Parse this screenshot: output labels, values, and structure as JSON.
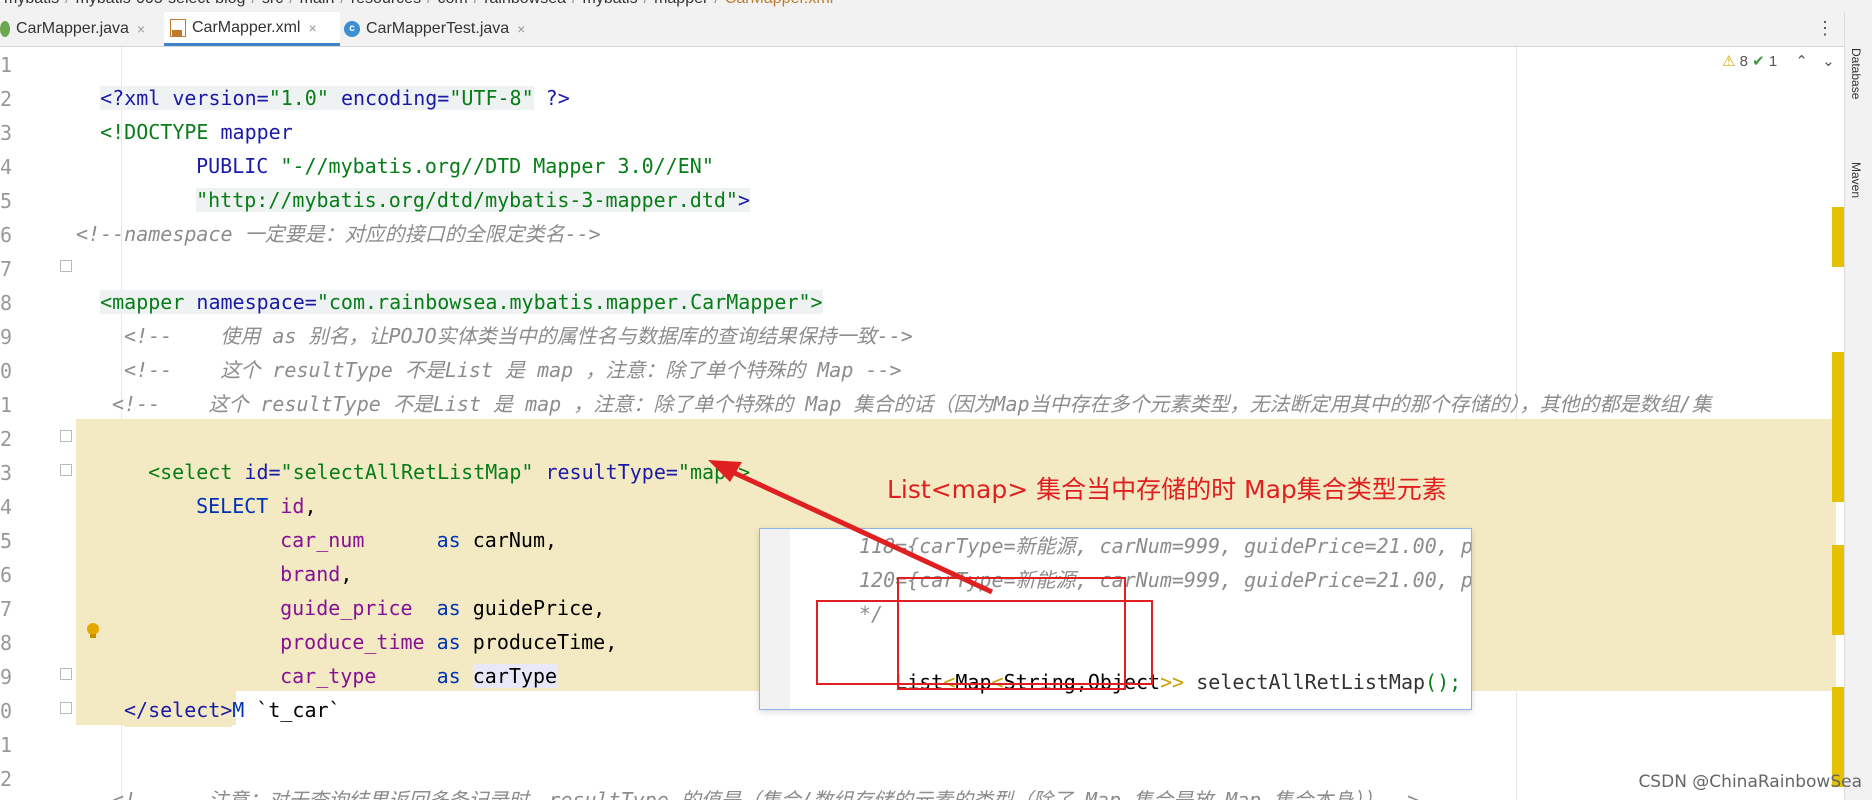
{
  "breadcrumb": [
    "mybatis",
    "mybatis-005-select-blog",
    "src",
    "main",
    "resources",
    "com",
    "rainbowsea",
    "mybatis",
    "mapper",
    "CarMapper.xml"
  ],
  "tabs": [
    {
      "label": "CarMapper.java",
      "icon": "interface-icon",
      "active": false
    },
    {
      "label": "CarMapper.xml",
      "icon": "xml-file-icon",
      "active": true
    },
    {
      "label": "CarMapperTest.java",
      "icon": "class-icon",
      "active": false
    }
  ],
  "tab_close_glyph": "×",
  "more_glyph": "⋮",
  "inspections": {
    "warnings": "8",
    "checks": "1",
    "warn_icon": "⚠",
    "check_icon": "✔",
    "up": "⌃",
    "down": "⌄"
  },
  "side_tabs": [
    "Database",
    "Maven"
  ],
  "line_numbers": [
    "1",
    "2",
    "3",
    "4",
    "5",
    "6",
    "7",
    "8",
    "9",
    "0",
    "1",
    "2",
    "3",
    "4",
    "5",
    "6",
    "7",
    "8",
    "9",
    "0",
    "1",
    "2"
  ],
  "code": {
    "l1": {
      "a": "<?",
      "b": "xml version=",
      "c": "\"1.0\"",
      "d": " encoding=",
      "e": "\"UTF-8\"",
      "f": " ?>"
    },
    "l2": {
      "a": "<!DOCTYPE ",
      "b": "mapper"
    },
    "l3": {
      "a": "PUBLIC ",
      "b": "\"-//mybatis.org//DTD Mapper 3.0//EN\""
    },
    "l4": {
      "a": "\"http://mybatis.org/dtd/mybatis-3-mapper.dtd\"",
      "b": ">"
    },
    "l6": "<!--namespace 一定要是：对应的接口的全限定类名-->",
    "l7": {
      "a": "<mapper ",
      "b": "namespace=",
      "c": "\"com.rainbowsea.mybatis.mapper.CarMapper\"",
      "d": ">"
    },
    "l9": "<!--    使用 as 别名，让POJO实体类当中的属性名与数据库的查询结果保持一致-->",
    "l10": "<!--    这个 resultType 不是List 是 map ，注意：除了单个特殊的 Map -->",
    "l11": "<!--    这个 resultType 不是List 是 map ，注意：除了单个特殊的 Map 集合的话（因为Map当中存在多个元素类型，无法断定用其中的那个存储的），其他的都是数组/集",
    "l12": {
      "a": "<select ",
      "b": "id=",
      "c": "\"selectAllRetListMap\"",
      "d": " resultType=",
      "e": "\"map\"",
      "f": ">"
    },
    "l13": {
      "a": "SELECT ",
      "b": "id",
      "c": ","
    },
    "l14": {
      "a": "car_num",
      "b": "      as ",
      "c": "carNum,"
    },
    "l15": {
      "a": "brand",
      "b": ","
    },
    "l16": {
      "a": "guide_price",
      "b": "  as ",
      "c": "guidePrice,"
    },
    "l17": {
      "a": "produce_time",
      "b": " as ",
      "c": "produceTime,"
    },
    "l18": {
      "a": "car_type",
      "b": "     as ",
      "c": "carType"
    },
    "l19": {
      "a": "FROM ",
      "b": "`t_car`"
    },
    "l20": "</select>",
    "l23": "<!--    注意：对于查询结果返回多条记录时，resultType 的值是（集合/数组存储的元素的类型（除了 Map 集合是放 Map 集合本身））-->"
  },
  "annotation": "List<map> 集合当中存储的时 Map集合类型元素",
  "popup": {
    "p1": "118={carType=新能源, carNum=999, guidePrice=21.00, p",
    "p2": "120={carType=新能源, carNum=999, guidePrice=21.00, p",
    "p3": "*/",
    "p4": {
      "a": "List",
      "b": "<",
      "c": "Map",
      "d": "<",
      "e": "String,Object",
      "f": ">>",
      "g": " selectAllRetListMap",
      "h": "();"
    }
  },
  "colors": {
    "annotation_red": "#e02020",
    "highlight": "#f3eac4",
    "scroll_mark": "#e5c100"
  },
  "watermark": "CSDN @ChinaRainbowSea"
}
